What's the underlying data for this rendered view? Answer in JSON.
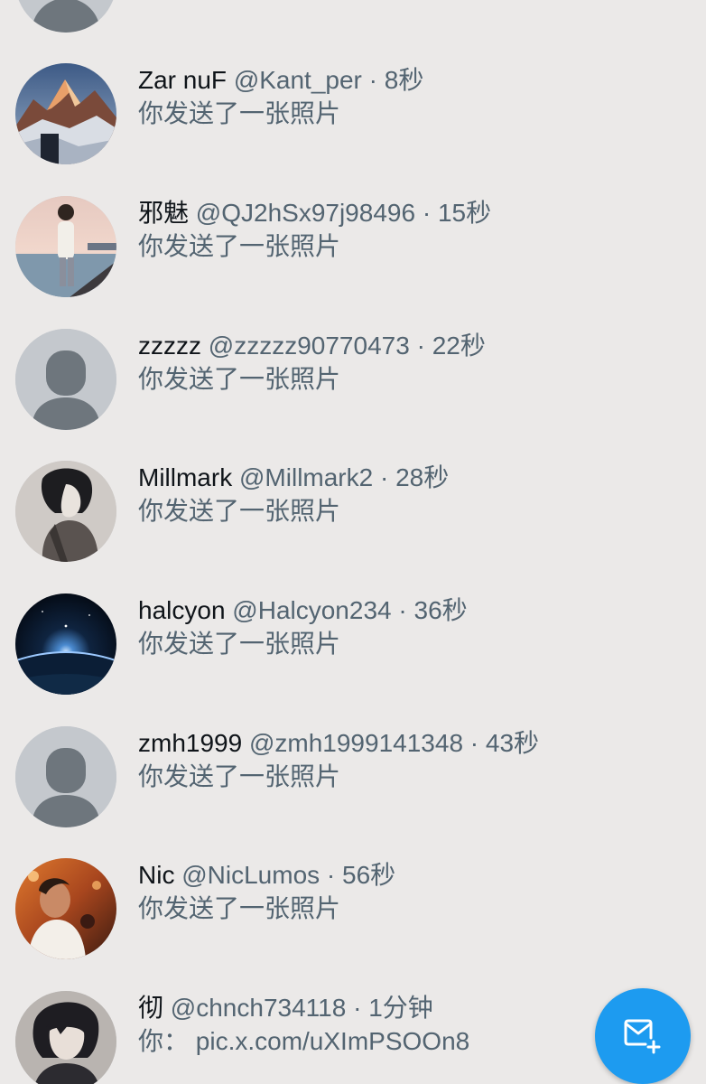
{
  "conversations": [
    {
      "name": "Zar nuF",
      "handle": "@Kant_per",
      "sep": "·",
      "time": "8秒",
      "preview": "你发送了一张照片",
      "avatar": "mountain-avatar"
    },
    {
      "name": "邪魅",
      "handle": "@QJ2hSx97j98496",
      "sep": "·",
      "time": "15秒",
      "preview": "你发送了一张照片",
      "avatar": "boy-at-sea-avatar"
    },
    {
      "name": "zzzzz",
      "handle": "@zzzzz90770473",
      "sep": "·",
      "time": "22秒",
      "preview": "你发送了一张照片",
      "avatar": "default-avatar"
    },
    {
      "name": "Millmark",
      "handle": "@Millmark2",
      "sep": "·",
      "time": "28秒",
      "preview": "你发送了一张照片",
      "avatar": "anime-boy-avatar"
    },
    {
      "name": "halcyon",
      "handle": "@Halcyon234",
      "sep": "·",
      "time": "36秒",
      "preview": "你发送了一张照片",
      "avatar": "earth-horizon-avatar"
    },
    {
      "name": "zmh1999",
      "handle": "@zmh1999141348",
      "sep": "·",
      "time": "43秒",
      "preview": "你发送了一张照片",
      "avatar": "default-avatar"
    },
    {
      "name": "Nic",
      "handle": "@NicLumos",
      "sep": "·",
      "time": "56秒",
      "preview": "你发送了一张照片",
      "avatar": "man-photo-avatar"
    },
    {
      "name": "彻",
      "handle": "@chnch734118",
      "sep": "·",
      "time": "1分钟",
      "preview": "你：  pic.x.com/uXImPSOOn8",
      "avatar": "anime-dark-hair-avatar"
    }
  ],
  "fab": {
    "icon": "new-message-icon",
    "color": "#1d9bf0"
  },
  "colors": {
    "background": "#ebe9e8",
    "primary_text": "#0f1419",
    "secondary_text": "#536471"
  }
}
